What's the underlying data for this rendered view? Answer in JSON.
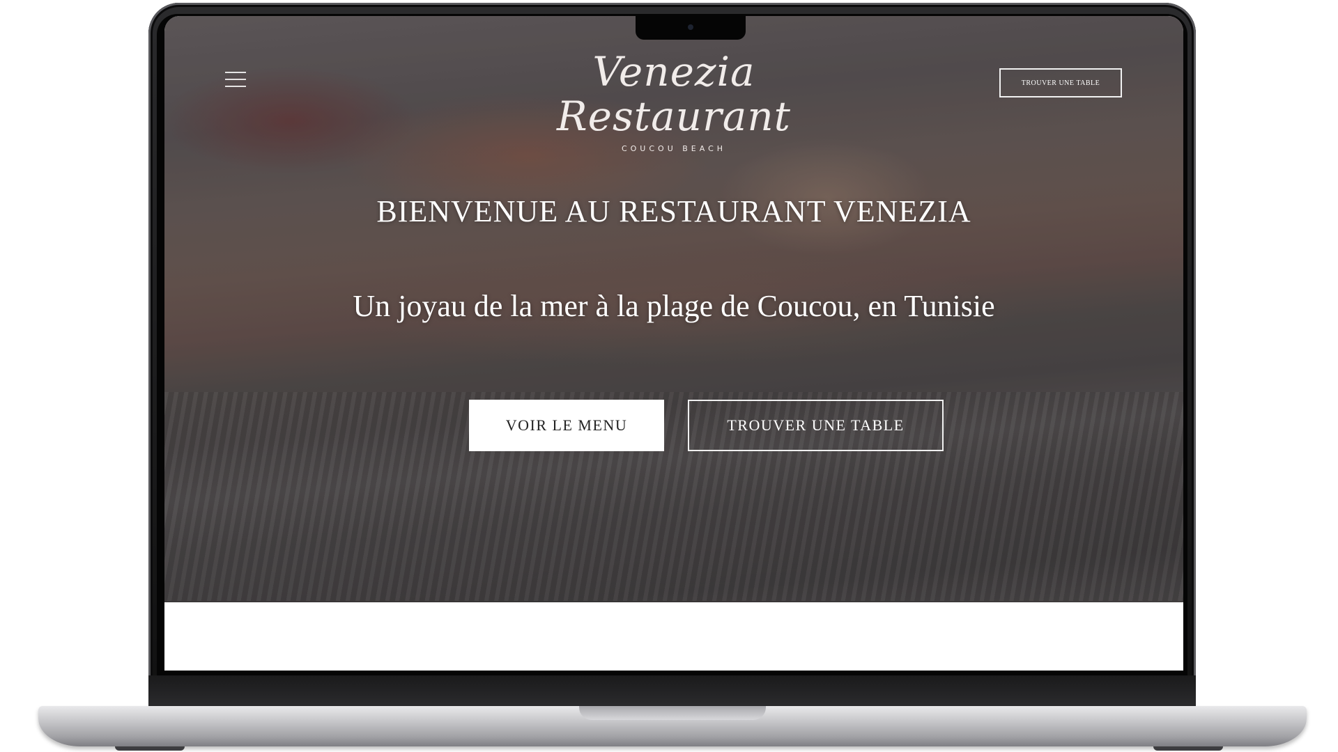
{
  "site": {
    "logo_script": "Venezia Restaurant",
    "logo_sub": "COUCOU BEACH"
  },
  "header": {
    "menu_icon": "hamburger-menu-icon",
    "cta_label": "TROUVER UNE TABLE"
  },
  "hero": {
    "headline": "BIENVENUE AU RESTAURANT VENEZIA",
    "subheadline": "Un joyau de la mer à la plage de Coucou, en Tunisie",
    "primary_button": "VOIR LE MENU",
    "secondary_button": "TROUVER UNE TABLE"
  },
  "colors": {
    "button_fill": "#ffffff",
    "text_light": "#ffffff",
    "overlay": "#5a5456"
  }
}
